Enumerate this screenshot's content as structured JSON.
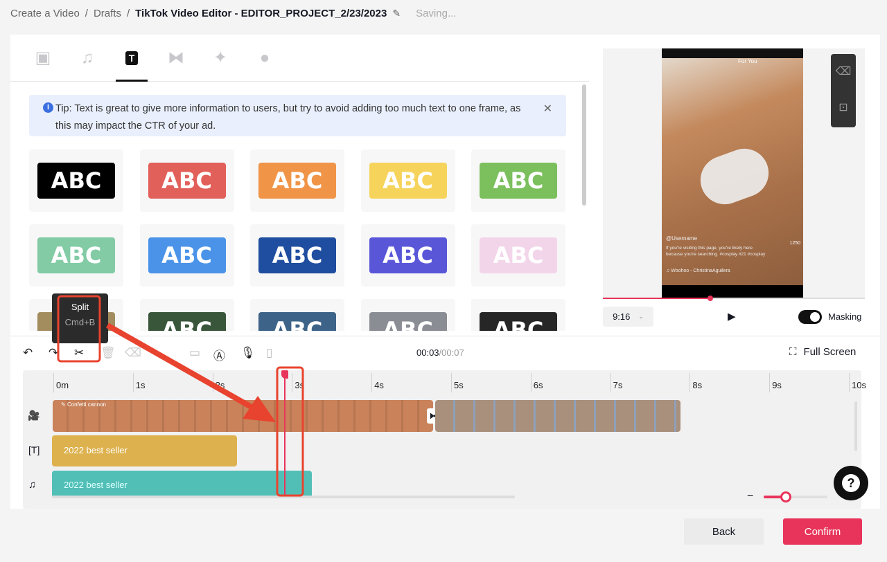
{
  "breadcrumb": {
    "items": [
      "Create a Video",
      "Drafts"
    ],
    "current": "TikTok Video Editor - EDITOR_PROJECT_2/23/2023",
    "status": "Saving..."
  },
  "tabs": [
    {
      "icon": "video-icon"
    },
    {
      "icon": "music-icon"
    },
    {
      "icon": "text-icon",
      "active": true
    },
    {
      "icon": "transition-icon"
    },
    {
      "icon": "effects-icon"
    },
    {
      "icon": "sticker-icon"
    }
  ],
  "tip": {
    "text": "Tip: Text is great to give more information to users, but try to avoid adding too much text to one frame, as this may impact the CTR of your ad."
  },
  "text_styles": [
    {
      "label": "ABC",
      "bg": "#000000",
      "fg": "#ffffff"
    },
    {
      "label": "ABC",
      "bg": "#e2605a",
      "fg": "#ffffff"
    },
    {
      "label": "ABC",
      "bg": "#f09548",
      "fg": "#ffffff"
    },
    {
      "label": "ABC",
      "bg": "#f6d45c",
      "fg": "#ffffff"
    },
    {
      "label": "ABC",
      "bg": "#7cbf5d",
      "fg": "#ffffff"
    },
    {
      "label": "ABC",
      "bg": "#82cba5",
      "fg": "#ffffff"
    },
    {
      "label": "ABC",
      "bg": "#4a93e8",
      "fg": "#ffffff"
    },
    {
      "label": "ABC",
      "bg": "#1f4d9f",
      "fg": "#ffffff"
    },
    {
      "label": "ABC",
      "bg": "#5957d8",
      "fg": "#ffffff"
    },
    {
      "label": "ABC",
      "bg": "#f3d5ea",
      "fg": "#ffffff"
    },
    {
      "label": "ABC",
      "bg": "#a38c5e",
      "fg": "#ffffff"
    },
    {
      "label": "ABC",
      "bg": "#39563b",
      "fg": "#ffffff"
    },
    {
      "label": "ABC",
      "bg": "#3d6488",
      "fg": "#ffffff"
    },
    {
      "label": "ABC",
      "bg": "#8b8d95",
      "fg": "#ffffff"
    },
    {
      "label": "ABC",
      "bg": "#262626",
      "fg": "#ffffff"
    }
  ],
  "preview": {
    "overlay_top": "For You",
    "username": "@Username",
    "caption": "If you're visiting this page, you're likely here because you're searching. #cosplay #21 #cosplay",
    "sound": "Woohoo - ChristinaAguilera",
    "likes": "1250",
    "progress": 0.41,
    "aspect": "9:16",
    "masking_label": "Masking",
    "masking_on": true
  },
  "tooltip": {
    "title": "Split",
    "shortcut": "Cmd+B"
  },
  "toolbar": {
    "time_current": "00:03",
    "time_total": "/00:07",
    "fullscreen": "Full Screen"
  },
  "timeline": {
    "ticks": [
      "0m",
      "1s",
      "2s",
      "3s",
      "4s",
      "5s",
      "6s",
      "7s",
      "8s",
      "9s",
      "10s"
    ],
    "playhead_seconds": 2.9,
    "effect_label": "Confetti cannon",
    "text_clip": "2022 best seller",
    "audio_clip": "2022 best seller",
    "zoom_level": 0.35
  },
  "actions": {
    "back": "Back",
    "confirm": "Confirm"
  },
  "colors": {
    "accent": "#e8345a",
    "annotation": "#e8432e"
  }
}
